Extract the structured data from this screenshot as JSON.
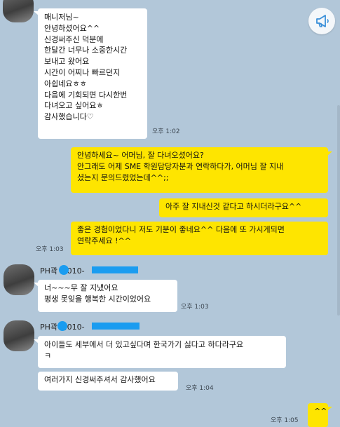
{
  "messages": [
    {
      "text": "매니저님~\n안녕하셨어요^^\n신경써주신 덕분에\n한달간 너무나 소중한시간\n보내고 왔어요\n시간이 어찌나 빠르던지\n아쉽네요ㅎㅎ\n다음에 기회되면 다시한번\n다녀오고 싶어요ㅎ\n감사했습니다♡",
      "time": "오후 1:02"
    },
    {
      "text": "안녕하세요~ 어머님, 잘 다녀오셨어요?\n안그래도 어제 SME 학원담당자분과 연락하다가, 어머님 잘 지내\n셨는지 문의드렸었는데^^;;"
    },
    {
      "text": "아주 잘 지내신것 같다고 하시더라구요^^"
    },
    {
      "text": "좋은 경험이었다니 저도 기분이 좋네요^^ 다음에 또 가시게되면\n연락주세요 !^^",
      "time": "오후 1:03"
    },
    {
      "sender": "PH곽  경010-",
      "text": "너~~~무 잘 지냈어요\n평생 못잊을 행복한 시간이었어요",
      "time": "오후 1:03"
    },
    {
      "sender": "PH곽  경010-",
      "text": "아이들도 세부에서 더 있고싶다며 한국가기 싫다고 하다라구요\nㅋ"
    },
    {
      "text": "여러가지 신경써주셔서 감사했어요",
      "time": "오후 1:04"
    },
    {
      "text": "^^",
      "time": "오후 1:05"
    }
  ],
  "icons": {
    "notice": "megaphone-icon"
  },
  "colors": {
    "background": "#b2c7d9",
    "my_bubble": "#fee500",
    "other_bubble": "#ffffff",
    "redaction": "#1a9cf0"
  }
}
